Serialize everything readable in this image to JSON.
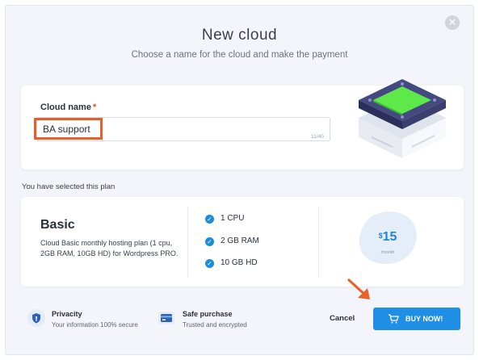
{
  "dialog": {
    "title": "New cloud",
    "subtitle": "Choose a name for the cloud and make the payment",
    "close_icon": "close-icon"
  },
  "cloud_name": {
    "label": "Cloud name",
    "required_marker": "*",
    "value": "BA support",
    "counter": "11/40"
  },
  "plan_section": {
    "heading": "You have selected this plan"
  },
  "plan": {
    "name": "Basic",
    "description": "Cloud Basic monthly hosting plan (1 cpu, 2GB RAM, 10GB HD) for Wordpress PRO.",
    "features": [
      "1 CPU",
      "2 GB RAM",
      "10 GB HD"
    ],
    "currency": "$",
    "price": "15",
    "period": "/month"
  },
  "trust": [
    {
      "icon": "shield-icon",
      "title": "Privacity",
      "subtitle": "Your information 100% secure"
    },
    {
      "icon": "credit-card-icon",
      "title": "Safe purchase",
      "subtitle": "Trusted and encrypted"
    }
  ],
  "actions": {
    "cancel_label": "Cancel",
    "buy_label": "BUY NOW!",
    "buy_icon": "cart-icon"
  },
  "colors": {
    "accent": "#1f8fe5",
    "highlight": "#e2622c",
    "background": "#f3f5fa"
  }
}
